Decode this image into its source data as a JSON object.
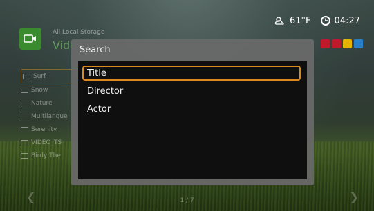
{
  "status": {
    "temperature": "61°F",
    "time": "04:27",
    "weather_icon": "cloud-icon",
    "clock_icon": "clock-icon"
  },
  "header": {
    "source_label": "All Local Storage",
    "section_title": "Video"
  },
  "view_buttons": {
    "colors": [
      "#c0192c",
      "#c0192c",
      "#e5b400",
      "#2a7fc9"
    ]
  },
  "file_list": {
    "items": [
      {
        "label": "Surf"
      },
      {
        "label": "Snow"
      },
      {
        "label": "Nature"
      },
      {
        "label": "Multilangue"
      },
      {
        "label": "Serenity"
      },
      {
        "label": "VIDEO_TS"
      },
      {
        "label": "Birdy The"
      }
    ],
    "selected_index": 0
  },
  "pagination": {
    "text": "1 / 7"
  },
  "search_dialog": {
    "title": "Search",
    "options": [
      {
        "label": "Title"
      },
      {
        "label": "Director"
      },
      {
        "label": "Actor"
      }
    ],
    "focused_index": 0,
    "focus_color": "#d88a1c"
  }
}
